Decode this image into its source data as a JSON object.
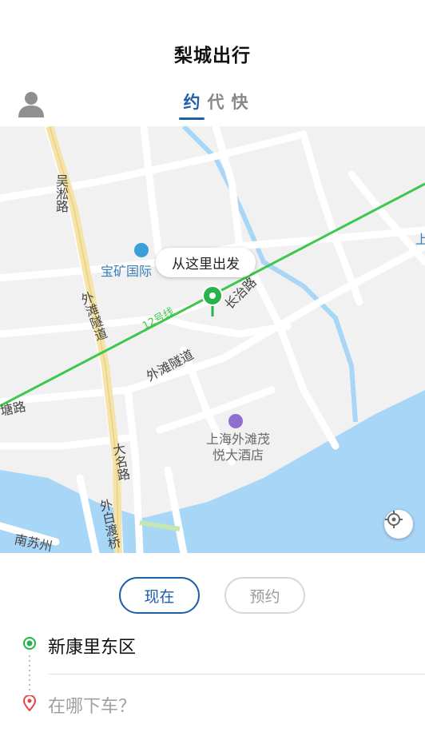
{
  "app": {
    "title": "梨城出行"
  },
  "tabs": [
    {
      "label": "约",
      "active": true
    },
    {
      "label": "代",
      "active": false
    },
    {
      "label": "快",
      "active": false
    }
  ],
  "map": {
    "callout": "从这里出发",
    "labels": {
      "wusong_road": "吴淞路",
      "baokuang": "宝矿国际",
      "bund_tunnel_v": "外滩隧道",
      "bund_tunnel_h": "外滩隧道",
      "line12": "12号线",
      "changzhi_road": "长治路",
      "hotel": "上海外滩茂悦大酒店",
      "daming_road": "大名路",
      "waibaidu": "外白渡桥",
      "nansuzhou": "南苏州",
      "tang_road": "塘路",
      "edge": "上"
    },
    "colors": {
      "water": "#a8d6f7",
      "metro": "#3fc74d",
      "road": "#ffffff",
      "highway": "#f5e3a8",
      "pin": "#28b24a"
    }
  },
  "time_options": {
    "now": "现在",
    "later": "预约"
  },
  "route": {
    "origin": "新康里东区",
    "destination_placeholder": "在哪下车？"
  }
}
